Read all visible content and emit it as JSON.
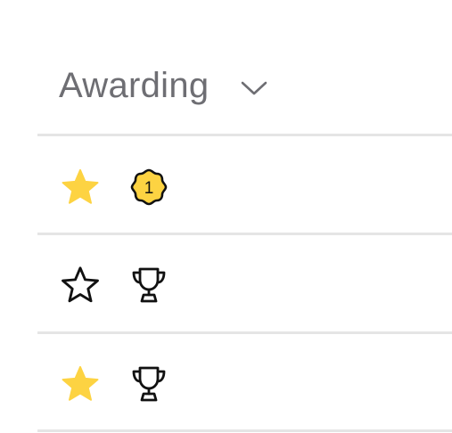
{
  "header": {
    "label": "Awarding",
    "icon": "chevron-down-icon"
  },
  "rows": [
    {
      "starred": true,
      "star_icon": "star-filled-icon",
      "badge_icon": "rank-medal-icon",
      "badge_text": "1"
    },
    {
      "starred": false,
      "star_icon": "star-outline-icon",
      "badge_icon": "trophy-icon"
    },
    {
      "starred": true,
      "star_icon": "star-filled-icon",
      "badge_icon": "trophy-icon"
    }
  ],
  "colors": {
    "header_text": "#6e6e73",
    "star_fill": "#fdd342",
    "medal_fill": "#fdd342",
    "icon_stroke": "#111111",
    "divider": "#e5e5e5"
  }
}
